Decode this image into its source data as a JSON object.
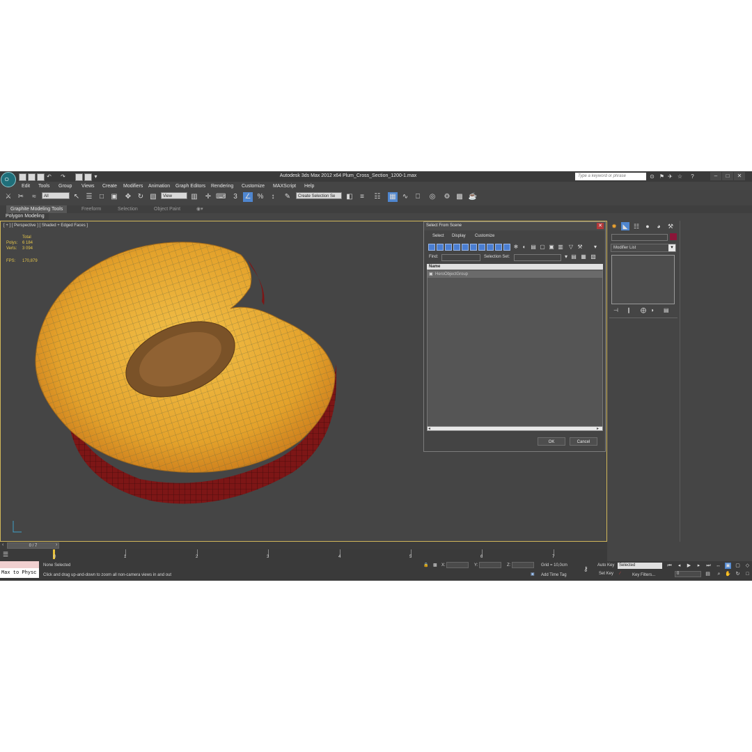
{
  "window": {
    "title": "Autodesk 3ds Max  2012 x64      Plum_Cross_Section_1200-1.max",
    "search_placeholder": "Type a keyword or phrase"
  },
  "menus": [
    "Edit",
    "Tools",
    "Group",
    "Views",
    "Create",
    "Modifiers",
    "Animation",
    "Graph Editors",
    "Rendering",
    "Customize",
    "MAXScript",
    "Help"
  ],
  "toolbar": {
    "filter_value": "All",
    "ref_coord_value": "View",
    "named_selection_value": "Create Selection Se"
  },
  "ribbon": {
    "tabs": [
      "Graphite Modeling Tools",
      "Freeform",
      "Selection",
      "Object Paint"
    ],
    "panel_label": "Polygon Modeling"
  },
  "viewport": {
    "label": "[ + ] [ Perspective ] [ Shaded + Edged Faces ]",
    "stats": {
      "total_label": "Total",
      "polys_label": "Polys:",
      "polys_value": "6 184",
      "verts_label": "Verts:",
      "verts_value": "3 094",
      "fps_label": "FPS:",
      "fps_value": "170,879"
    },
    "mesh_colors": {
      "flesh": "#e4a22b",
      "skin": "#8a1a1a",
      "pit": "#7a5228"
    }
  },
  "dialog": {
    "title": "Select From Scene",
    "menus": [
      "Select",
      "Display",
      "Customize"
    ],
    "find_label": "Find:",
    "selection_set_label": "Selection Set:",
    "column_header": "Name",
    "items": [
      "HeroObjectGroup"
    ],
    "ok_label": "OK",
    "cancel_label": "Cancel"
  },
  "command_panel": {
    "modifier_list_label": "Modifier List",
    "color_swatch": "#8b1538"
  },
  "timeline": {
    "frame_readout": "0 / 7",
    "ticks": [
      "0",
      "1",
      "2",
      "3",
      "4",
      "5",
      "6",
      "7"
    ]
  },
  "status": {
    "maxscript_listener": "Max to Physc",
    "selection_status": "None Selected",
    "prompt": "Click and drag up-and-down to zoom all non-camera views in and out",
    "x_label": "X:",
    "y_label": "Y:",
    "z_label": "Z:",
    "grid_text": "Grid = 10,0cm",
    "add_time_tag": "Add Time Tag",
    "auto_key_label": "Auto Key",
    "set_key_label": "Set Key",
    "selected_value": "Selected",
    "key_filters_label": "Key Filters...",
    "frame_value": "0"
  }
}
